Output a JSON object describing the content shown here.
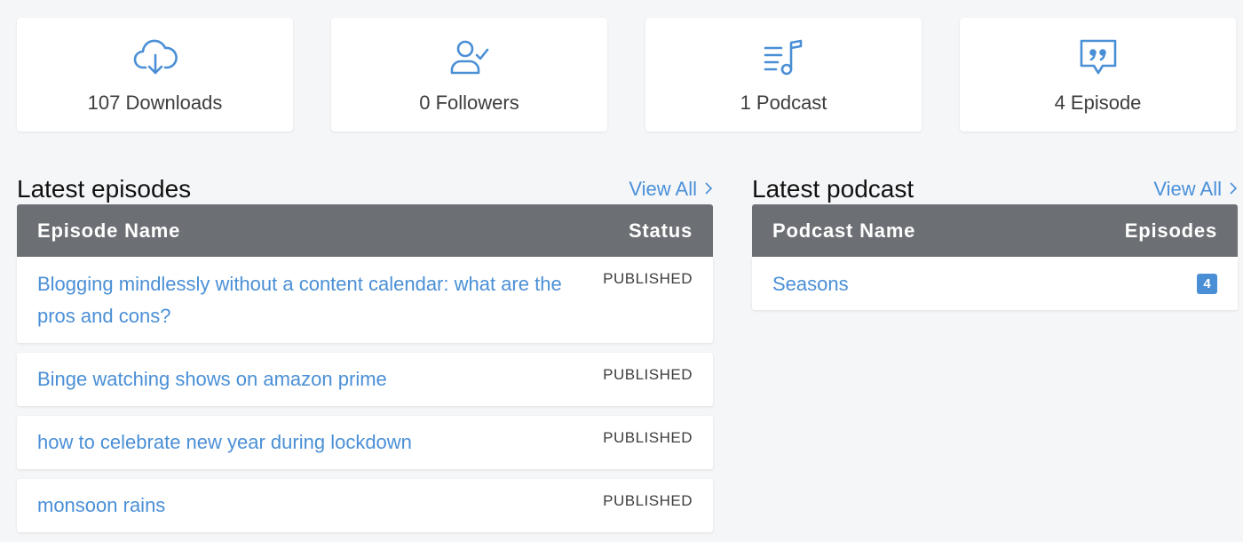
{
  "stats": [
    {
      "icon": "cloud-download-icon",
      "label": "107 Downloads"
    },
    {
      "icon": "user-check-icon",
      "label": "0 Followers"
    },
    {
      "icon": "music-list-icon",
      "label": "1 Podcast"
    },
    {
      "icon": "quote-bubble-icon",
      "label": "4 Episode"
    }
  ],
  "episodes_panel": {
    "title": "Latest episodes",
    "view_all": "View All",
    "columns": {
      "name": "Episode Name",
      "status": "Status"
    },
    "rows": [
      {
        "name": "Blogging mindlessly without a content calendar: what are the pros and cons?",
        "status": "PUBLISHED"
      },
      {
        "name": "Binge watching shows on amazon prime",
        "status": "PUBLISHED"
      },
      {
        "name": "how to celebrate new year during lockdown",
        "status": "PUBLISHED"
      },
      {
        "name": "monsoon rains",
        "status": "PUBLISHED"
      }
    ]
  },
  "podcast_panel": {
    "title": "Latest podcast",
    "view_all": "View All",
    "columns": {
      "name": "Podcast Name",
      "episodes": "Episodes"
    },
    "rows": [
      {
        "name": "Seasons",
        "episodes": "4"
      }
    ]
  },
  "colors": {
    "accent": "#4a8fd6",
    "table_header": "#6c6f73",
    "background": "#f5f6f8"
  }
}
